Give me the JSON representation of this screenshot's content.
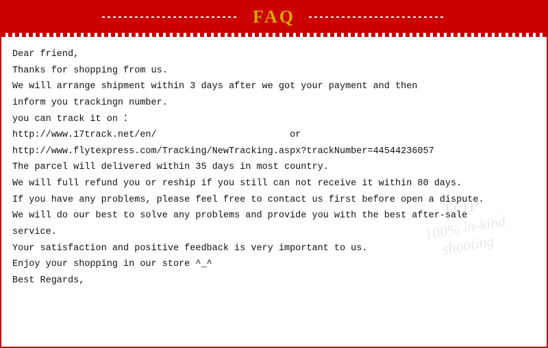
{
  "header": {
    "title": "FAQ",
    "border_color": "#cc0000",
    "title_color": "#d4a800"
  },
  "content": {
    "lines": [
      "Dear friend,",
      "Thanks for shopping from us.",
      "We will arrange shipment within 3 days after we got your payment and then",
      "inform you trackingn number.",
      "you can track it on ：",
      "http://www.17track.net/en/                        or",
      "http://www.flytexpress.com/Tracking/NewTracking.aspx?trackNumber=44544236057",
      "The parcel will delivered within 35 days in most country.",
      "We will full refund you or reship if you still can not receive it within 80 days.",
      "If you have any problems, please feel free to contact us first before open a dispute.",
      "We will do our best to solve any problems and provide you with the best after-sale",
      "service.",
      "Your satisfaction and positive feedback is very important to us.",
      "Enjoy your shopping in our store ^_^",
      "Best Regards,"
    ]
  },
  "watermark": {
    "top": "TOP",
    "bottom": "100% in-kind\nshooting"
  }
}
